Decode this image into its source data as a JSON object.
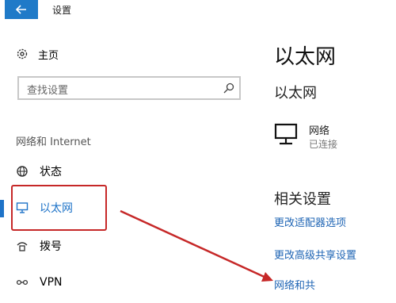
{
  "window": {
    "title": "设置"
  },
  "sidebar": {
    "home_label": "主页",
    "search_placeholder": "查找设置",
    "section_heading": "网络和 Internet",
    "items": [
      {
        "label": "状态",
        "icon": "globe-icon"
      },
      {
        "label": "以太网",
        "icon": "ethernet-icon",
        "selected": true
      },
      {
        "label": "拨号",
        "icon": "dialup-icon"
      },
      {
        "label": "VPN",
        "icon": "vpn-icon"
      }
    ]
  },
  "main": {
    "title": "以太网",
    "subtitle": "以太网",
    "network": {
      "name": "网络",
      "status": "已连接",
      "icon": "network-monitor-icon"
    },
    "related_title": "相关设置",
    "links": [
      "更改适配器选项",
      "更改高级共享设置",
      "网络和共"
    ]
  },
  "colors": {
    "accent": "#1e73c8",
    "link": "#1e64b4",
    "annotation": "#c62828"
  }
}
